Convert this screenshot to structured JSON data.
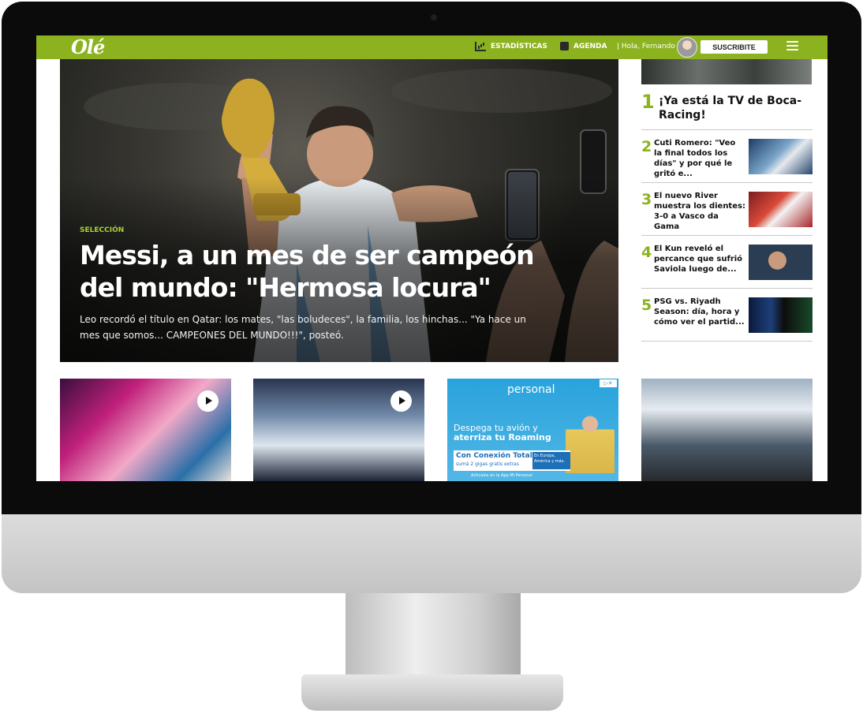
{
  "header": {
    "logo": "Olé",
    "nav": [
      {
        "label": "ESTADÍSTICAS",
        "icon": "stats-icon"
      },
      {
        "label": "AGENDA",
        "icon": "calendar-icon"
      }
    ],
    "greeting": "| Hola, Fernando",
    "subscribe_label": "SUSCRIBITE",
    "menu_icon": "hamburger-menu-icon"
  },
  "hero": {
    "kicker": "SELECCIÓN",
    "title": "Messi, a un mes de ser campeón del mundo: \"Hermosa locura\"",
    "summary": "Leo recordó el título en Qatar: los mates, \"las boludeces\", la familia, los hinchas... \"Ya hace un mes que somos... CAMPEONES DEL MUNDO!!!\", posteó."
  },
  "ranking": [
    {
      "num": "1",
      "title": "¡Ya está la TV de Boca-Racing!"
    },
    {
      "num": "2",
      "title": "Cuti Romero: \"Veo la final todos los días\" y por qué le gritó e..."
    },
    {
      "num": "3",
      "title": "El nuevo River muestra los dientes: 3-0 a Vasco da Gama"
    },
    {
      "num": "4",
      "title": "El Kun reveló el percance que sufrió Saviola luego de..."
    },
    {
      "num": "5",
      "title": "PSG vs. Riyadh Season: día, hora y cómo ver el partid..."
    }
  ],
  "ad": {
    "brand": "personal",
    "line1": "Despega tu avión y",
    "line2": "aterriza tu Roaming",
    "box_title": "Con Conexión Total",
    "box_sub": "sumá 2 gigas gratis extras",
    "box_right": "En Europa, América y más.",
    "footer": "Activalos en la App Mi Personal"
  },
  "colors": {
    "brand_green": "#8cb31f",
    "kicker_green": "#a9d139",
    "ad_blue": "#29a3dc"
  }
}
